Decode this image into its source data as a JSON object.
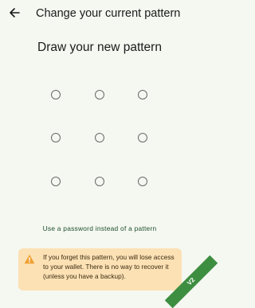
{
  "app_bar": {
    "title": "Change your current pattern",
    "back_icon": "arrow-left-icon"
  },
  "main": {
    "heading": "Draw your new pattern",
    "pattern_dot_count": 9,
    "alt_link": "Use a password instead of a pattern"
  },
  "warning": {
    "icon": "warning-triangle-icon",
    "text": "If you forget this pattern, you will lose access to your wallet. There is no way to recover it (unless you have a backup)."
  },
  "badge": {
    "text": "V2"
  },
  "colors": {
    "background": "#F4F8F1",
    "warning_bg": "#FCE1B5",
    "warning_icon": "#F0A030",
    "link": "#1F4E2C",
    "badge": "#3E8E41"
  }
}
